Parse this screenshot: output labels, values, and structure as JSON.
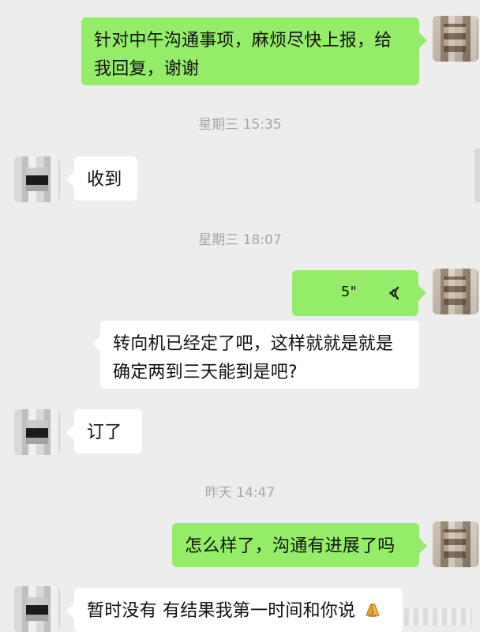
{
  "messages": [
    {
      "sender": "me",
      "text": "针对中午沟通事项，麻烦尽快上报，给我回复，谢谢"
    },
    {
      "sender": "other",
      "text": "收到"
    },
    {
      "sender": "me",
      "voice": "5\""
    },
    {
      "sender": "other",
      "text": "转向机已经定了吧，这样就就是就是确定两到三天能到是吧?"
    },
    {
      "sender": "other",
      "text": "订了"
    },
    {
      "sender": "me",
      "text": "怎么样了，沟通有进展了吗"
    },
    {
      "sender": "other",
      "text": "暂时没有 有结果我第一时间和你说"
    }
  ],
  "timestamps": [
    "星期三 15:35",
    "星期三 18:07",
    "昨天 14:47"
  ],
  "icons": {
    "voice": "voice-wave-icon",
    "emoji": "pray-icon"
  },
  "colors": {
    "background": "#ededed",
    "my_bubble": "#95ec69",
    "other_bubble": "#ffffff",
    "timestamp": "#a6a6a6"
  }
}
